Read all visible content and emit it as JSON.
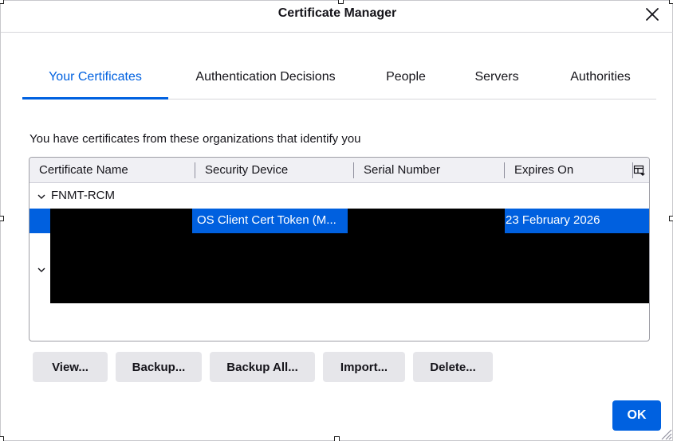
{
  "window": {
    "title": "Certificate Manager"
  },
  "tabs": [
    {
      "label": "Your Certificates",
      "active": true
    },
    {
      "label": "Authentication Decisions",
      "active": false
    },
    {
      "label": "People",
      "active": false
    },
    {
      "label": "Servers",
      "active": false
    },
    {
      "label": "Authorities",
      "active": false
    }
  ],
  "intro_text": "You have certificates from these organizations that identify you",
  "table": {
    "columns": [
      "Certificate Name",
      "Security Device",
      "Serial Number",
      "Expires On"
    ],
    "groups": [
      {
        "name": "FNMT-RCM",
        "expanded": true,
        "rows": [
          {
            "certificate_name": "",
            "security_device": "OS Client Cert Token (M...",
            "serial_number": "",
            "expires_on": "23 February 2026",
            "selected": true
          }
        ]
      },
      {
        "name": "",
        "expanded": true,
        "rows": []
      }
    ]
  },
  "buttons": {
    "view": "View...",
    "backup": "Backup...",
    "backup_all": "Backup All...",
    "import": "Import...",
    "delete": "Delete...",
    "ok": "OK"
  },
  "icons": {
    "close": "close-icon",
    "column_picker": "column-picker-icon",
    "twisty": "chevron-down-icon",
    "resize_grip": "resize-grip-icon"
  },
  "colors": {
    "accent": "#0061e0",
    "selection": "#0060df",
    "button_bg": "#e6e6ea",
    "redaction": "#000000"
  }
}
